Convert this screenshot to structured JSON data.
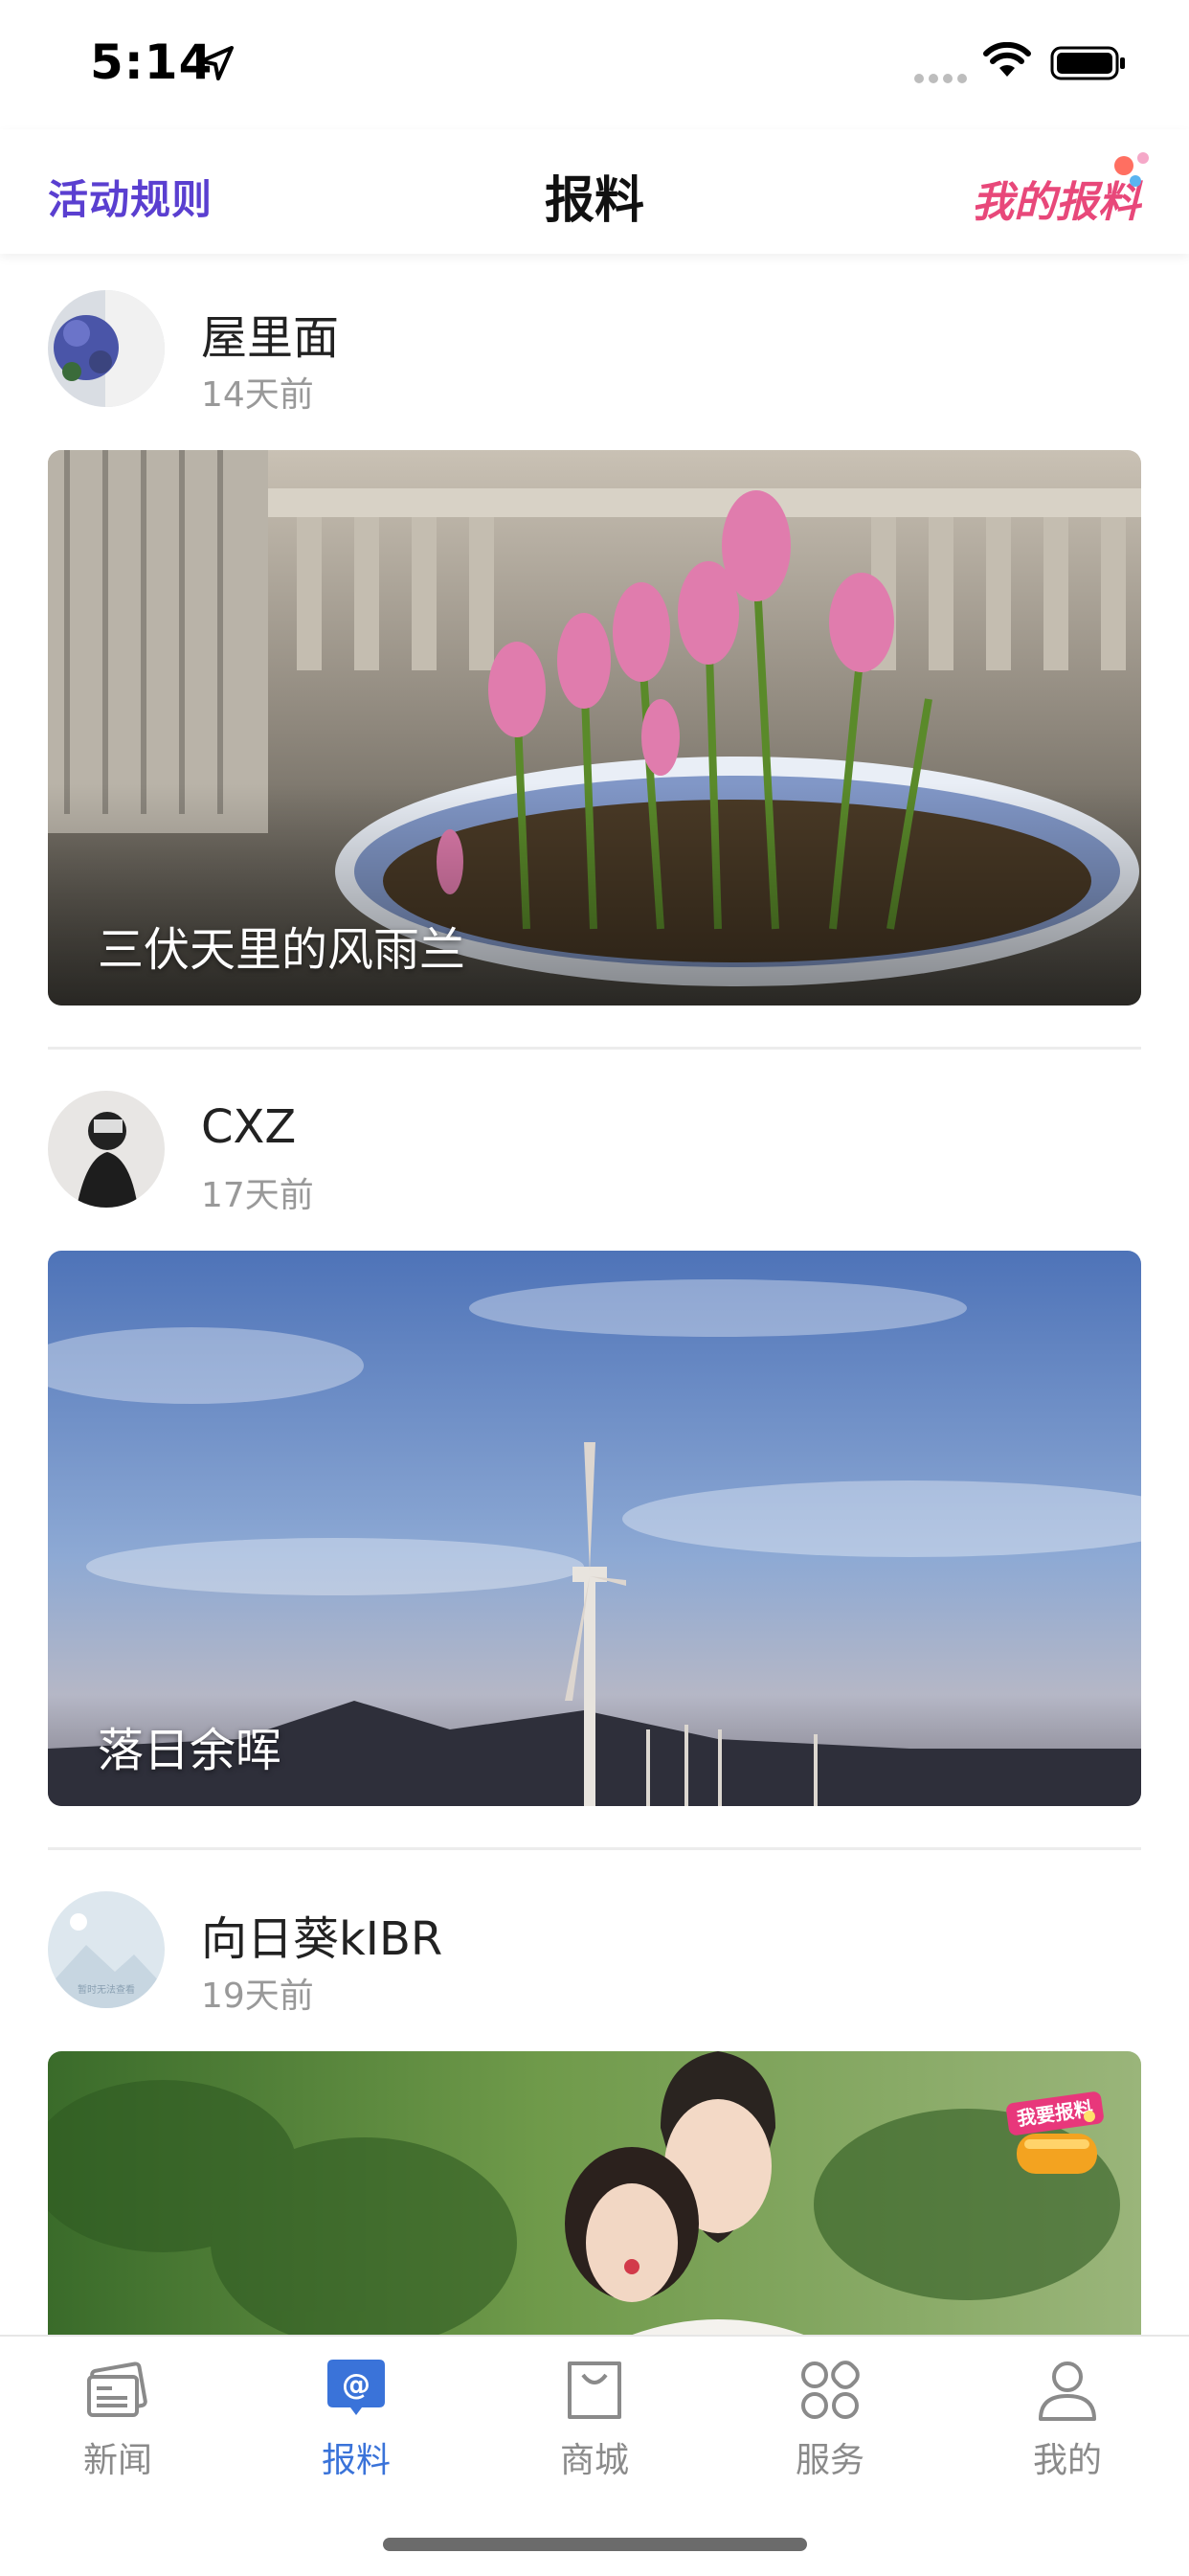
{
  "status": {
    "time": "5:14"
  },
  "nav": {
    "left": "活动规则",
    "title": "报料",
    "right": "我的报料"
  },
  "posts": [
    {
      "user": "屋里面",
      "time": "14天前",
      "caption": "三伏天里的风雨兰"
    },
    {
      "user": "CXZ",
      "time": "17天前",
      "caption": "落日余晖"
    },
    {
      "user": "向日葵kIBR",
      "time": "19天前",
      "caption": "",
      "avatar_text": "暂时无法查看",
      "badge_text": "我要报料"
    }
  ],
  "tabs": [
    {
      "label": "新闻",
      "icon": "newspaper-icon"
    },
    {
      "label": "报料",
      "icon": "at-icon"
    },
    {
      "label": "商城",
      "icon": "shopping-bag-icon"
    },
    {
      "label": "服务",
      "icon": "grid-services-icon"
    },
    {
      "label": "我的",
      "icon": "person-icon"
    }
  ],
  "colors": {
    "accent": "#3a73d9",
    "rules": "#5a3fd0",
    "my_report": "#e8487a"
  }
}
